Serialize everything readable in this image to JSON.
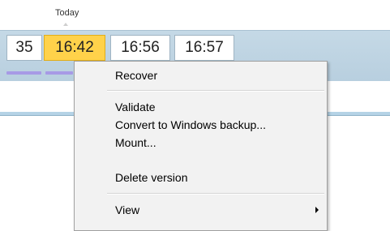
{
  "timeline": {
    "today_label": "Today",
    "slots": [
      "35",
      "16:42",
      "16:56",
      "16:57"
    ],
    "selected_index": 1
  },
  "context_menu": {
    "items": [
      {
        "label": "Recover"
      },
      {
        "label": "Validate"
      },
      {
        "label": "Convert to Windows backup..."
      },
      {
        "label": "Mount..."
      },
      {
        "label": "Delete version"
      },
      {
        "label": "View",
        "has_submenu": true
      }
    ]
  },
  "colors": {
    "selected_slot": "#ffd24a",
    "timeline_band": "#c5d9e6",
    "slot_accent": "#a79ae6",
    "menu_background": "#f2f2f2"
  }
}
